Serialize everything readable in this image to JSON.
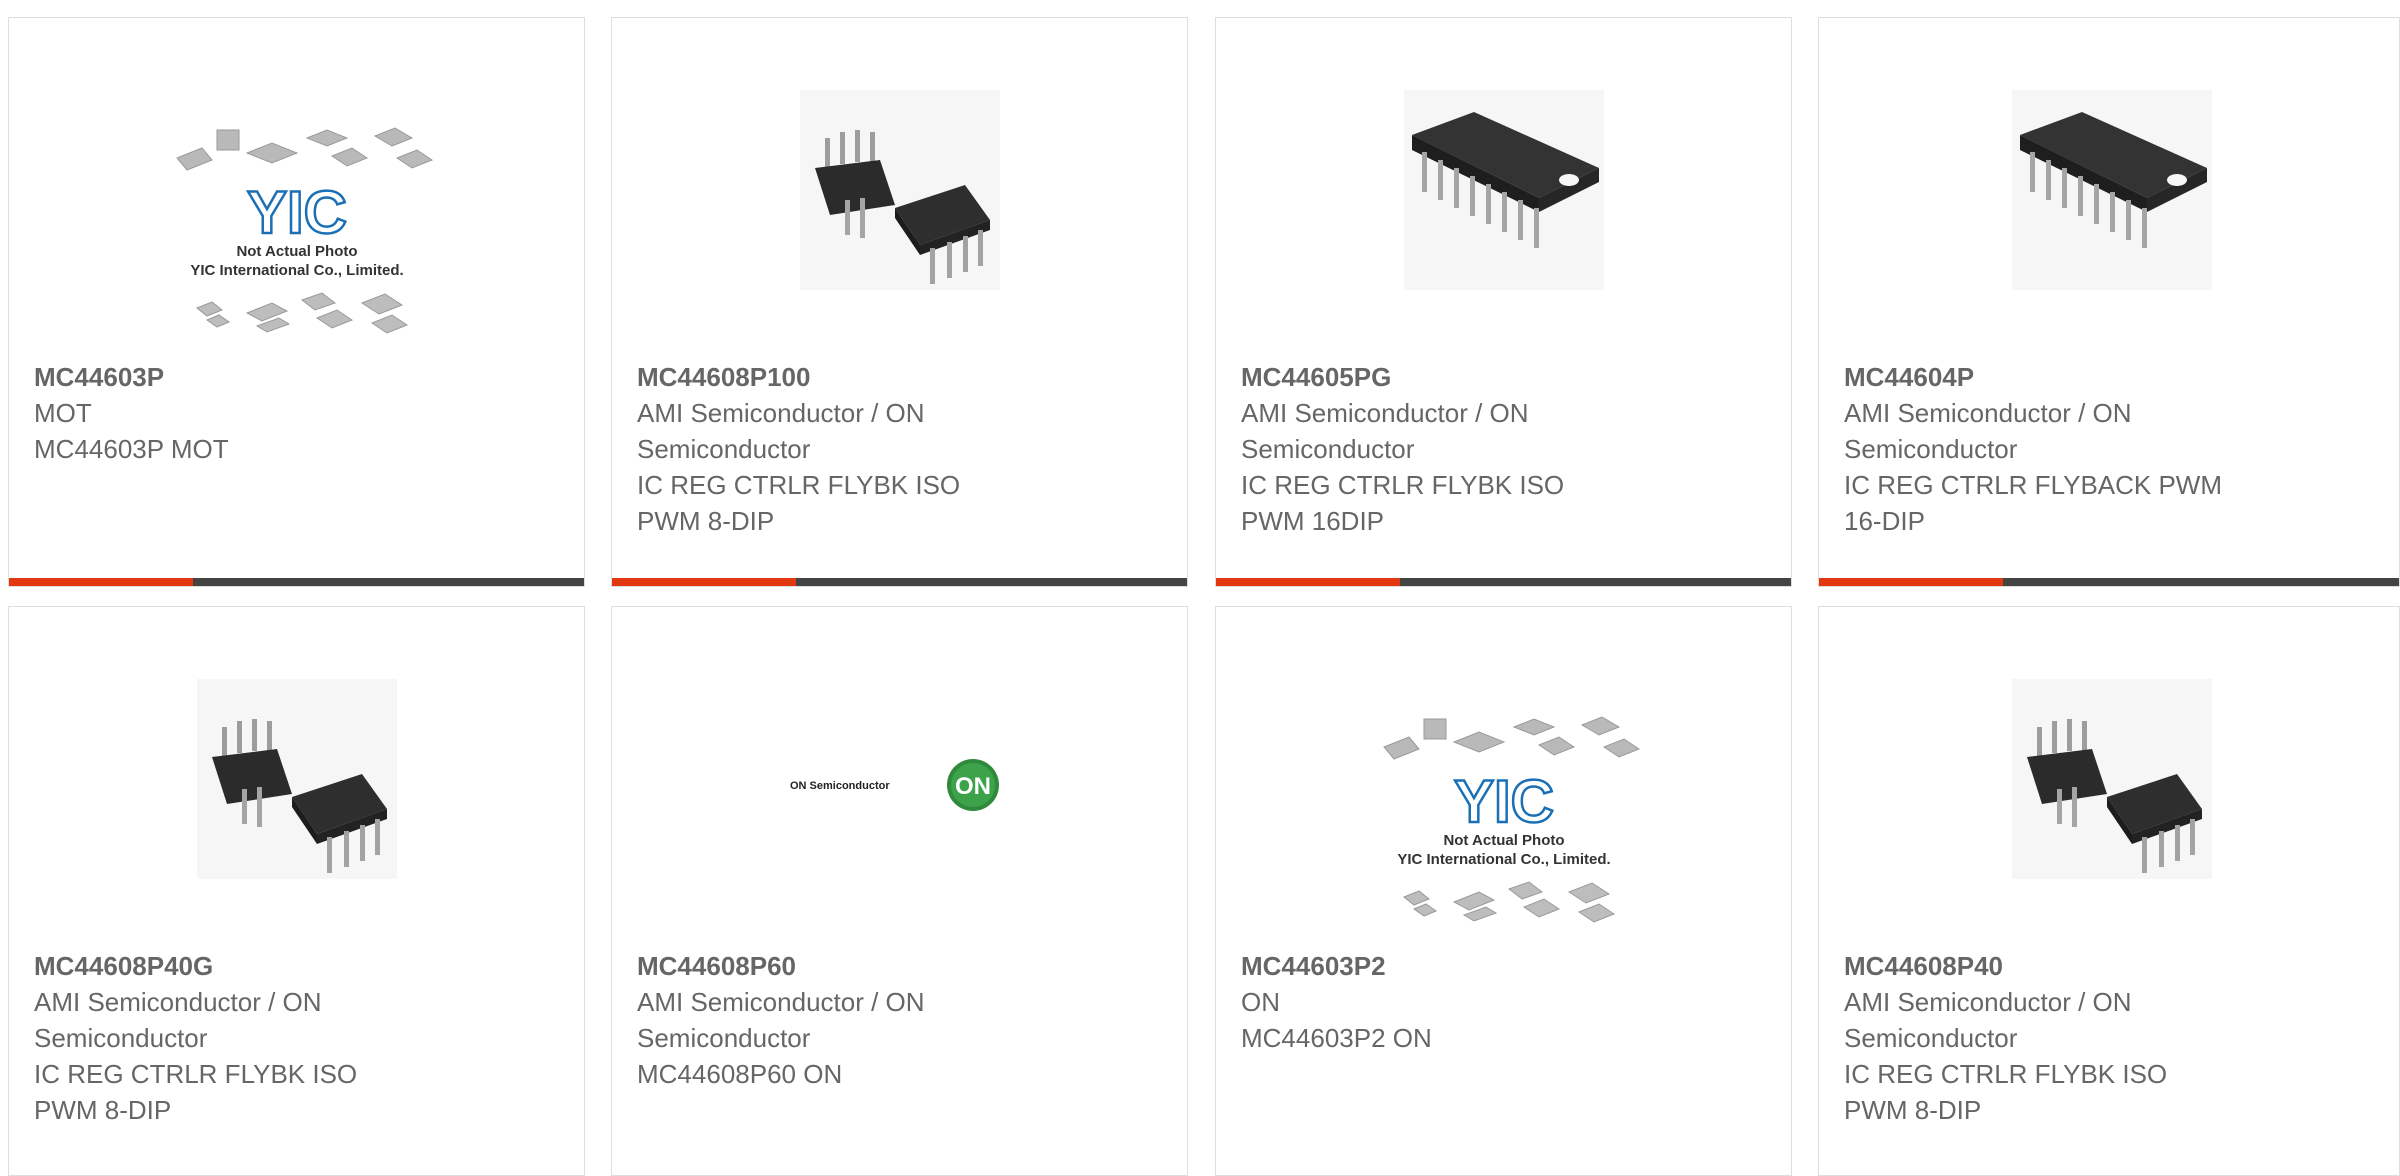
{
  "colors": {
    "accent": "#e3380f",
    "bar": "#444444",
    "text": "#666666",
    "border": "#dedede"
  },
  "cards": [
    {
      "part": "MC44603P",
      "lines": [
        "MOT",
        "MC44603P MOT"
      ],
      "image": "yic-placeholder",
      "placeholder": {
        "line1": "Not Actual Photo",
        "line2": "YIC International Co., Limited.",
        "logo": "YIC"
      }
    },
    {
      "part": "MC44608P100",
      "lines": [
        "AMI Semiconductor / ON",
        "Semiconductor",
        "IC REG CTRLR FLYBK ISO",
        "PWM 8-DIP"
      ],
      "image": "dip8"
    },
    {
      "part": "MC44605PG",
      "lines": [
        "AMI Semiconductor / ON",
        "Semiconductor",
        "IC REG CTRLR FLYBK ISO",
        "PWM 16DIP"
      ],
      "image": "dip16"
    },
    {
      "part": "MC44604P",
      "lines": [
        "AMI Semiconductor / ON",
        "Semiconductor",
        "IC REG CTRLR FLYBACK PWM",
        "16-DIP"
      ],
      "image": "dip16"
    },
    {
      "part": "MC44608P40G",
      "lines": [
        "AMI Semiconductor / ON",
        "Semiconductor",
        "IC REG CTRLR FLYBK ISO",
        "PWM 8-DIP"
      ],
      "image": "dip8"
    },
    {
      "part": "MC44608P60",
      "lines": [
        "AMI Semiconductor / ON",
        "Semiconductor",
        "MC44608P60 ON"
      ],
      "image": "on-logo",
      "logo": {
        "wordmark": "ON Semiconductor",
        "badge": "ON"
      }
    },
    {
      "part": "MC44603P2",
      "lines": [
        "ON",
        "MC44603P2 ON"
      ],
      "image": "yic-placeholder",
      "placeholder": {
        "line1": "Not Actual Photo",
        "line2": "YIC International Co., Limited.",
        "logo": "YIC"
      }
    },
    {
      "part": "MC44608P40",
      "lines": [
        "AMI Semiconductor / ON",
        "Semiconductor",
        "IC REG CTRLR FLYBK ISO",
        "PWM 8-DIP"
      ],
      "image": "dip8"
    }
  ]
}
